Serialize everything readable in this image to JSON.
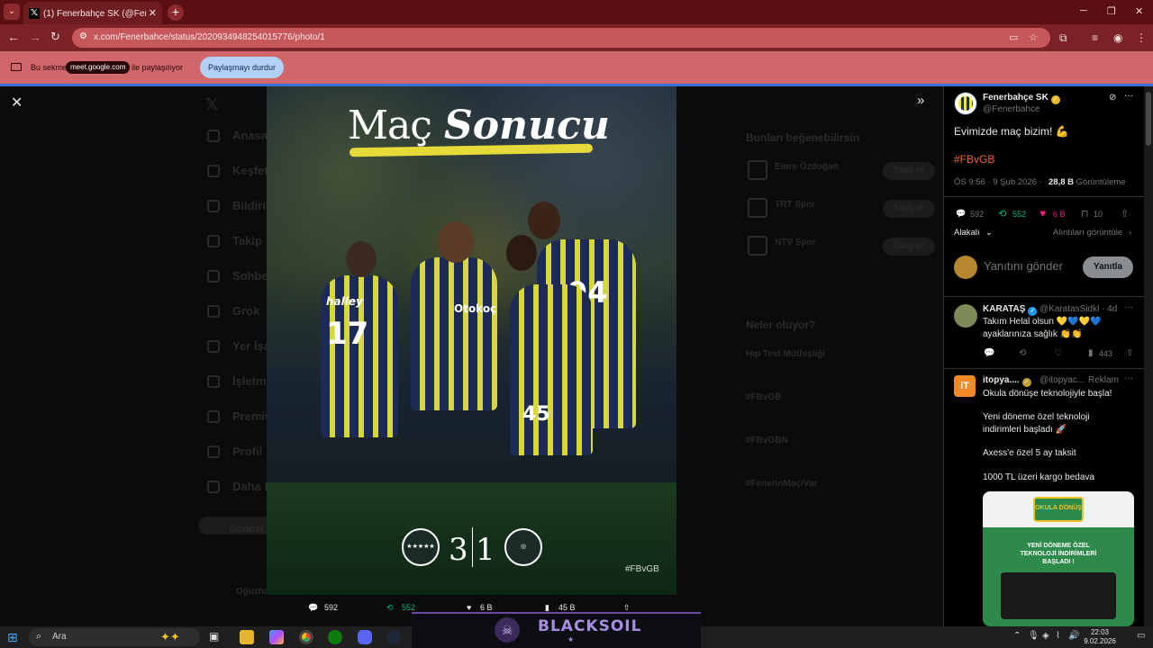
{
  "browser": {
    "tab_title": "(1) Fenerbahçe SK (@Fenerb",
    "url": "x.com/Fenerbahce/status/2020934948254015776/photo/1",
    "share_prefix": "Bu sekme",
    "share_chip": "meet.google.com",
    "share_suffix": "ile paylaşılıyor",
    "stop_share_button": "Paylaşmayı durdur"
  },
  "background_page": {
    "nav": [
      "Anasayfa",
      "Keşfet",
      "Bildirimler",
      "Takip",
      "Sohbet",
      "Grok",
      "Yer İşaretleri",
      "İşletme",
      "Premium",
      "Profil",
      "Daha fazla"
    ],
    "post_button": "Gönder",
    "suggest_title": "Bunları beğenebilirsin",
    "suggestions": [
      {
        "name": "Emre Özdoğan",
        "follow": "Takip et"
      },
      {
        "name": "TRT Spor",
        "follow": "Takip et"
      },
      {
        "name": "NTV Spor",
        "follow": "Takip et"
      }
    ],
    "trends_title": "Neler oluyor?",
    "trends": [
      "Hıp Test Müthişliği",
      "#FBvGB",
      "#FBvGBN",
      "#FenerinMaçıVar"
    ],
    "bottom_user": "Oğuzhan"
  },
  "photo": {
    "title_plain": "Maç",
    "title_italic": "Sonucu",
    "home_score": "3",
    "away_score": "1",
    "hashtag": "#FBvGB",
    "numbers": [
      "17",
      "94",
      "45"
    ],
    "sponsor": "Otokoç",
    "sponsor2": "halley"
  },
  "photo_actions": {
    "replies": "592",
    "reposts": "552",
    "likes": "6 B",
    "views": "45 B"
  },
  "tweet": {
    "name": "Fenerbahçe SK",
    "handle": "@Fenerbahce",
    "text": "Evimizde maç bizim! 💪",
    "hashtag": "#FBvGB",
    "time": "ÖS 9:56 · 9 Şub 2026 ·",
    "views_count": "28,8 B",
    "views_label": "Görüntüleme",
    "replies": "592",
    "reposts": "552",
    "likes": "6 B",
    "bookmarks": "10",
    "sort_label": "Alakalı",
    "quotes_link": "Alıntıları görüntüle",
    "reply_placeholder": "Yanıtını gönder",
    "reply_button": "Yanıtla"
  },
  "replies": [
    {
      "name": "KARATAŞ",
      "handle": "@KaratasSidkl · 4d",
      "line1": "Takım Helal olsun 💛💙💛💙",
      "line2": "ayaklarınıza sağlık 👏👏",
      "views": "443"
    }
  ],
  "ad": {
    "name": "itopya....",
    "handle": "@itopyac...",
    "label": "Reklam",
    "line1": "Okula dönüşe teknolojiyle başla!",
    "line2": "Yeni döneme özel teknoloji",
    "line3": "indirimleri başladı 🚀",
    "line4": "Axess'e özel 5 ay taksit",
    "line5": "1000 TL üzeri kargo bedava",
    "image_text1": "YENİ DÖNEME ÖZEL",
    "image_text2": "TEKNOLOJİ İNDİRİMLERİ",
    "image_text3": "BAŞLADI !",
    "image_badge": "OKULA DÖNÜŞ"
  },
  "taskbar": {
    "search": "Ara",
    "overlay_brand": "BLACKSOIL",
    "time": "22:03",
    "date": "9.02.2026"
  },
  "colors": {
    "tab_bar": "#5a0f12",
    "toolbar": "#7a2226",
    "share_bar": "#d0676a",
    "hashtag": "#f4633a",
    "repost": "#00ba7c",
    "like": "#f91880",
    "verified": "#1d9bf0"
  }
}
